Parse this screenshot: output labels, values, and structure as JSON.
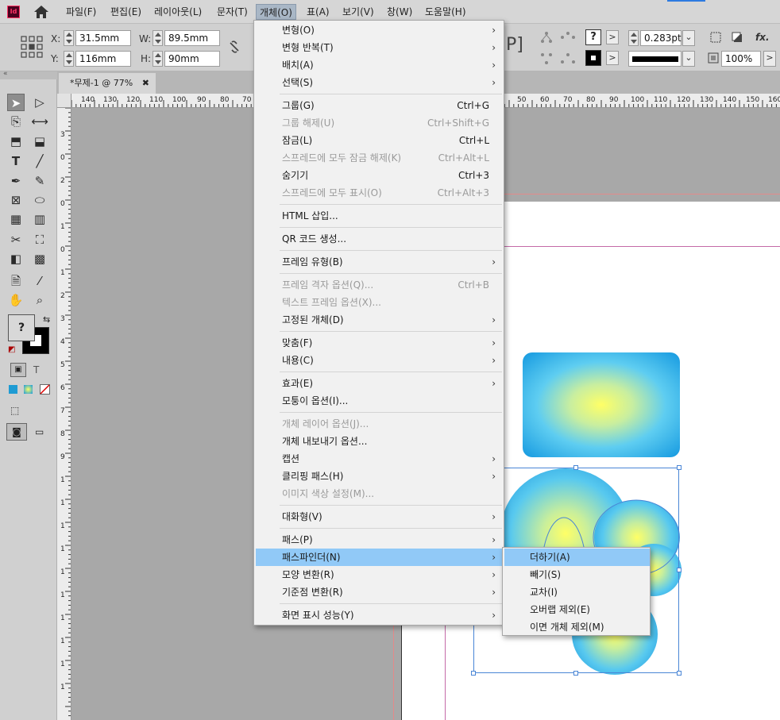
{
  "menubar": {
    "logo": "Id",
    "items": [
      "파일(F)",
      "편집(E)",
      "레이아웃(L)",
      "문자(T)",
      "개체(O)",
      "표(A)",
      "보기(V)",
      "창(W)",
      "도움말(H)"
    ]
  },
  "control_panel": {
    "x_label": "X:",
    "x_value": "31.5mm",
    "y_label": "Y:",
    "y_value": "116mm",
    "w_label": "W:",
    "w_value": "89.5mm",
    "h_label": "H:",
    "h_value": "90mm",
    "stroke_weight": "0.283pt",
    "opacity": "100%",
    "fx_label": "fx."
  },
  "document_tab": {
    "title": "*무제-1 @ 77%",
    "close": "✖"
  },
  "h_ruler_ticks": [
    "140",
    "130",
    "120",
    "110",
    "100",
    "90",
    "80",
    "70",
    "50",
    "60",
    "70",
    "80",
    "90",
    "100",
    "110",
    "120",
    "130",
    "140",
    "150",
    "160"
  ],
  "v_ruler_ticks": [
    "3",
    "0",
    "2",
    "0",
    "1",
    "0",
    "1",
    "2",
    "3",
    "4",
    "5",
    "6",
    "7",
    "8",
    "9",
    "1",
    "1",
    "1",
    "1",
    "1",
    "1",
    "1",
    "1",
    "1",
    "1"
  ],
  "object_menu": {
    "items": [
      {
        "label": "변형(O)",
        "shortcut": "",
        "submenu": true,
        "disabled": false
      },
      {
        "label": "변형 반복(T)",
        "shortcut": "",
        "submenu": true,
        "disabled": false
      },
      {
        "label": "배치(A)",
        "shortcut": "",
        "submenu": true,
        "disabled": false
      },
      {
        "label": "선택(S)",
        "shortcut": "",
        "submenu": true,
        "disabled": false
      },
      {
        "label": "그룹(G)",
        "shortcut": "Ctrl+G",
        "submenu": false,
        "disabled": false
      },
      {
        "label": "그룹 해제(U)",
        "shortcut": "Ctrl+Shift+G",
        "submenu": false,
        "disabled": true
      },
      {
        "label": "잠금(L)",
        "shortcut": "Ctrl+L",
        "submenu": false,
        "disabled": false
      },
      {
        "label": "스프레드에 모두 잠금 해제(K)",
        "shortcut": "Ctrl+Alt+L",
        "submenu": false,
        "disabled": true
      },
      {
        "label": "숨기기",
        "shortcut": "Ctrl+3",
        "submenu": false,
        "disabled": false
      },
      {
        "label": "스프레드에 모두 표시(O)",
        "shortcut": "Ctrl+Alt+3",
        "submenu": false,
        "disabled": true
      },
      {
        "label": "HTML 삽입...",
        "shortcut": "",
        "submenu": false,
        "disabled": false
      },
      {
        "label": "QR 코드 생성...",
        "shortcut": "",
        "submenu": false,
        "disabled": false
      },
      {
        "label": "프레임 유형(B)",
        "shortcut": "",
        "submenu": true,
        "disabled": false
      },
      {
        "label": "프레임 격자 옵션(Q)...",
        "shortcut": "Ctrl+B",
        "submenu": false,
        "disabled": true
      },
      {
        "label": "텍스트 프레임 옵션(X)...",
        "shortcut": "",
        "submenu": false,
        "disabled": true
      },
      {
        "label": "고정된 개체(D)",
        "shortcut": "",
        "submenu": true,
        "disabled": false
      },
      {
        "label": "맞춤(F)",
        "shortcut": "",
        "submenu": true,
        "disabled": false
      },
      {
        "label": "내용(C)",
        "shortcut": "",
        "submenu": true,
        "disabled": false
      },
      {
        "label": "효과(E)",
        "shortcut": "",
        "submenu": true,
        "disabled": false
      },
      {
        "label": "모퉁이 옵션(I)...",
        "shortcut": "",
        "submenu": false,
        "disabled": false
      },
      {
        "label": "개체 레이어 옵션(J)...",
        "shortcut": "",
        "submenu": false,
        "disabled": true
      },
      {
        "label": "개체 내보내기 옵션...",
        "shortcut": "",
        "submenu": false,
        "disabled": false
      },
      {
        "label": "캡션",
        "shortcut": "",
        "submenu": true,
        "disabled": false
      },
      {
        "label": "클리핑 패스(H)",
        "shortcut": "",
        "submenu": true,
        "disabled": false
      },
      {
        "label": "이미지 색상 설정(M)...",
        "shortcut": "",
        "submenu": false,
        "disabled": true
      },
      {
        "label": "대화형(V)",
        "shortcut": "",
        "submenu": true,
        "disabled": false
      },
      {
        "label": "패스(P)",
        "shortcut": "",
        "submenu": true,
        "disabled": false
      },
      {
        "label": "패스파인더(N)",
        "shortcut": "",
        "submenu": true,
        "disabled": false
      },
      {
        "label": "모양 변환(R)",
        "shortcut": "",
        "submenu": true,
        "disabled": false
      },
      {
        "label": "기준점 변환(R)",
        "shortcut": "",
        "submenu": true,
        "disabled": false
      },
      {
        "label": "화면 표시 성능(Y)",
        "shortcut": "",
        "submenu": true,
        "disabled": false
      }
    ]
  },
  "pathfinder_submenu": {
    "items": [
      "더하기(A)",
      "빼기(S)",
      "교차(I)",
      "오버랩 제외(E)",
      "이면 개체 제외(M)"
    ]
  },
  "colors": {
    "menu_highlight": "#91c9f7",
    "gradient_center": "#ffff66",
    "gradient_edge": "#1599e0",
    "selection": "#4a86d6"
  }
}
